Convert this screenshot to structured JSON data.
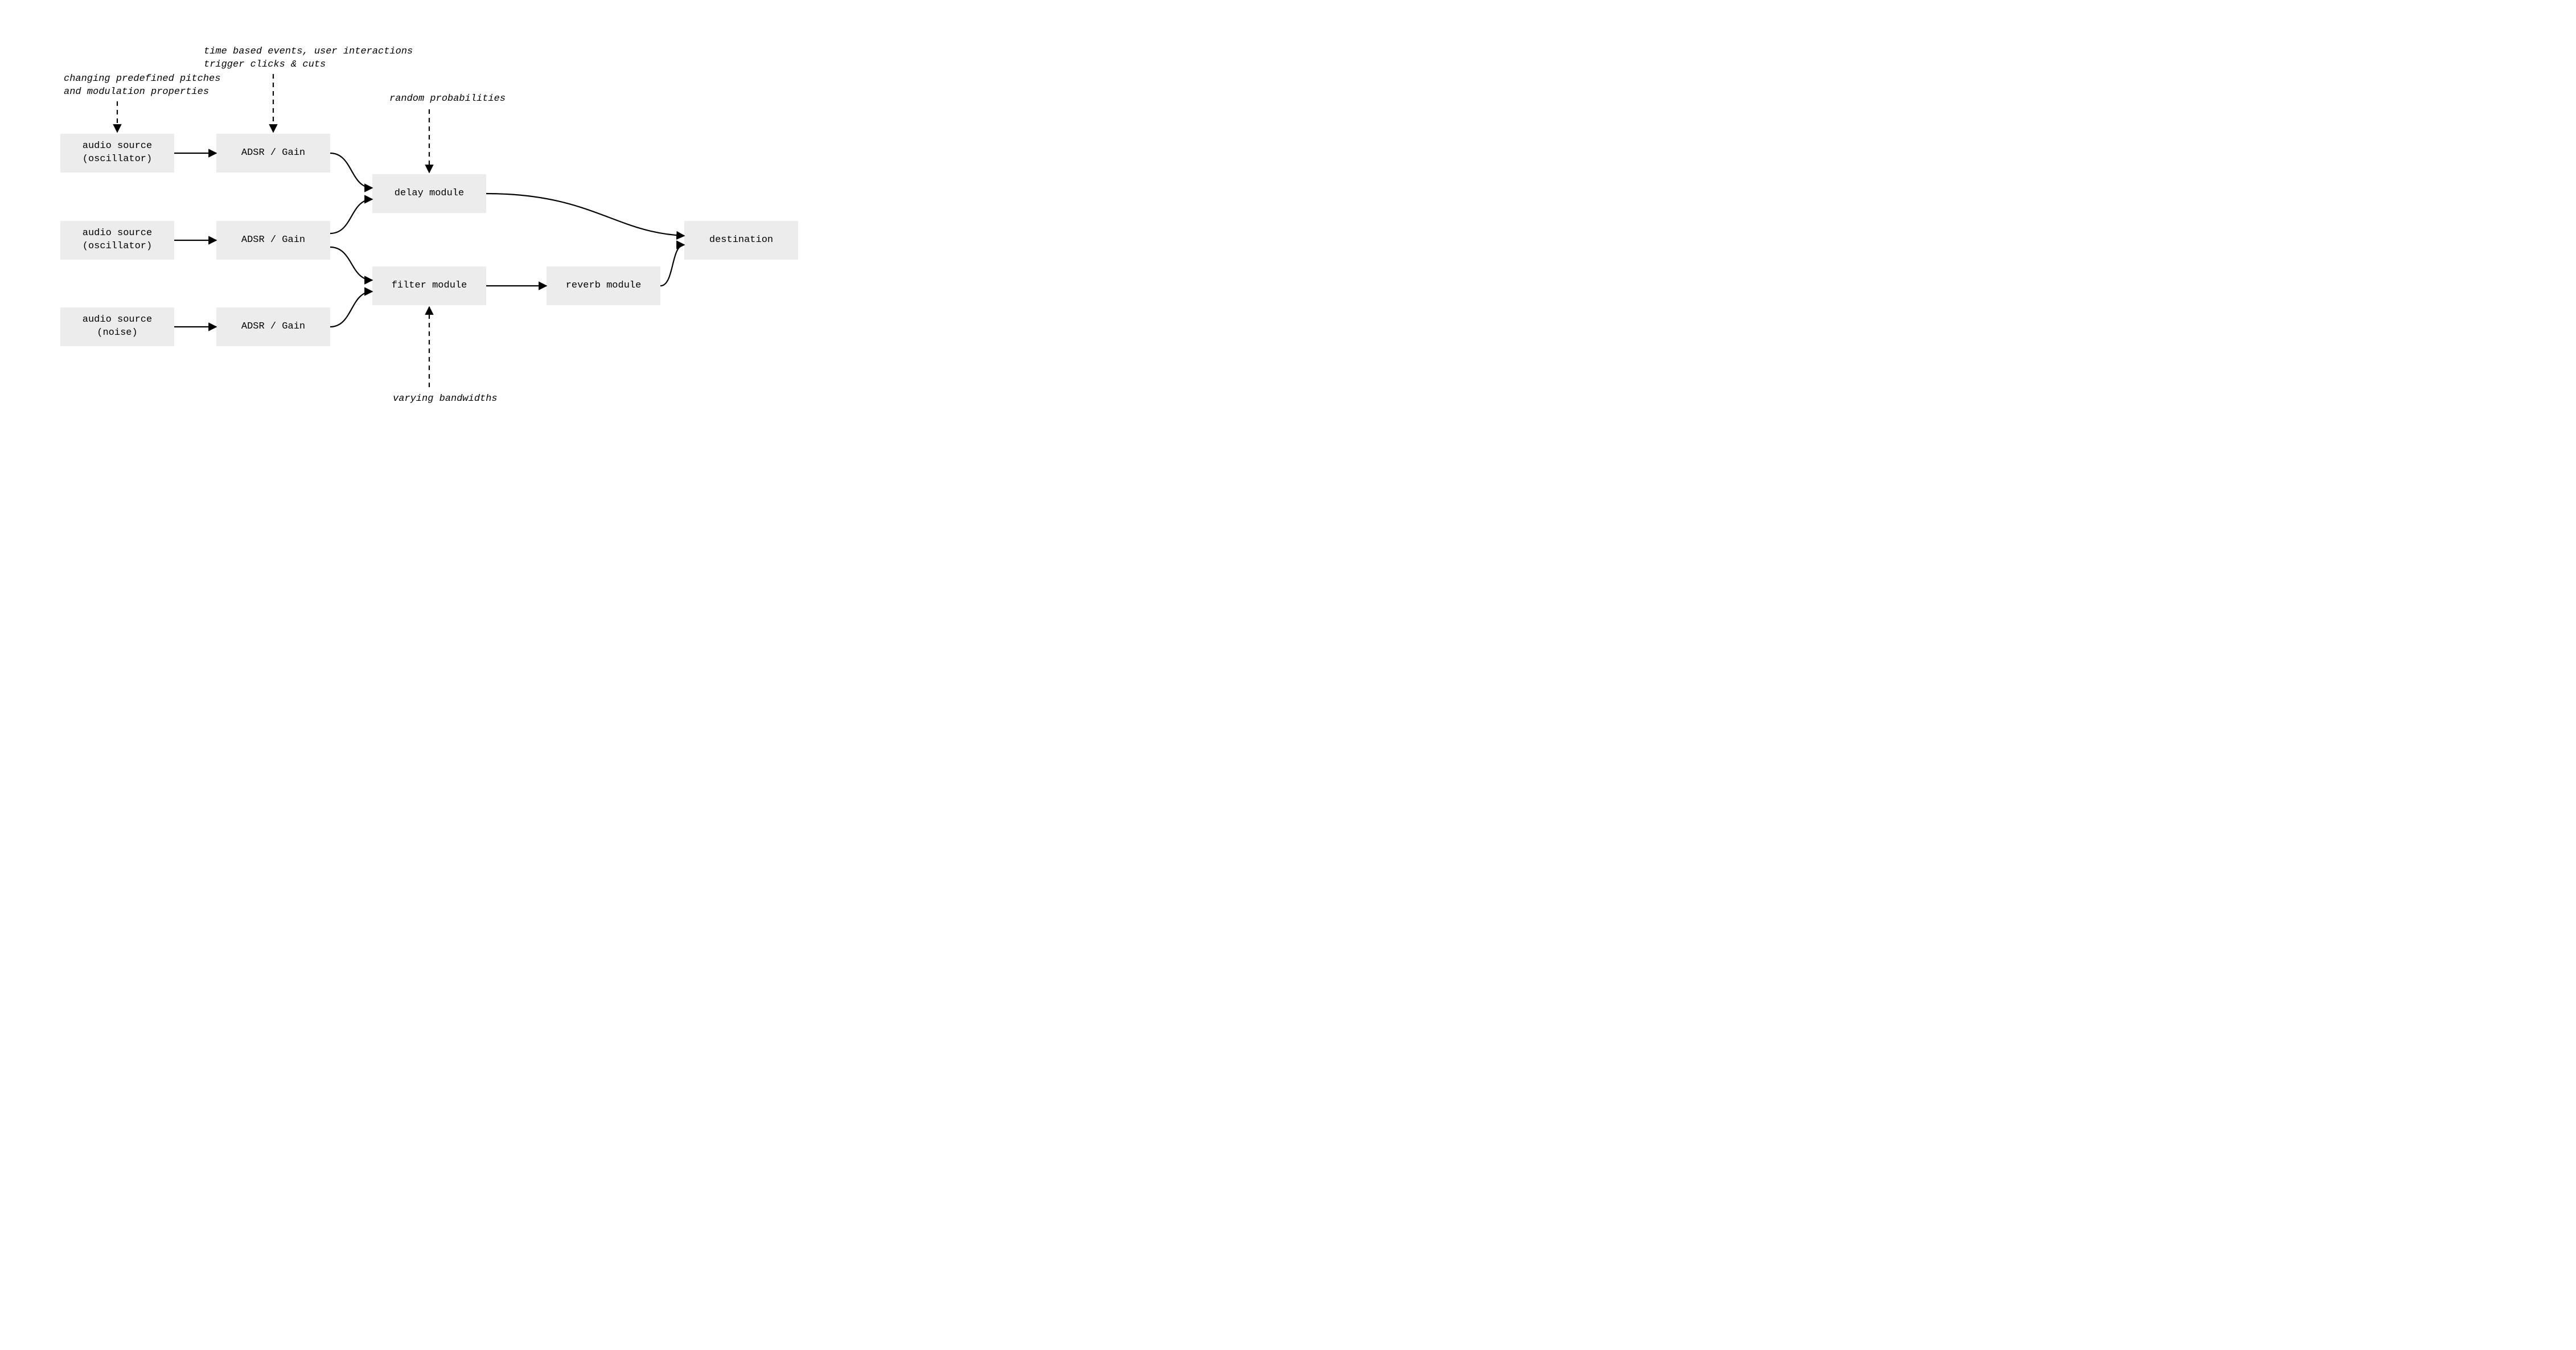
{
  "nodes": {
    "src_osc1": "audio source\n(oscillator)",
    "src_osc2": "audio source\n(oscillator)",
    "src_noise": "audio source\n(noise)",
    "adsr1": "ADSR / Gain",
    "adsr2": "ADSR / Gain",
    "adsr3": "ADSR / Gain",
    "delay": "delay module",
    "filter": "filter module",
    "reverb": "reverb module",
    "dest": "destination"
  },
  "annotations": {
    "pitches": "changing predefined pitches\nand modulation properties",
    "events": "time based events, user interactions\ntrigger clicks & cuts",
    "random": "random probabilities",
    "bandwidths": "varying bandwidths"
  }
}
